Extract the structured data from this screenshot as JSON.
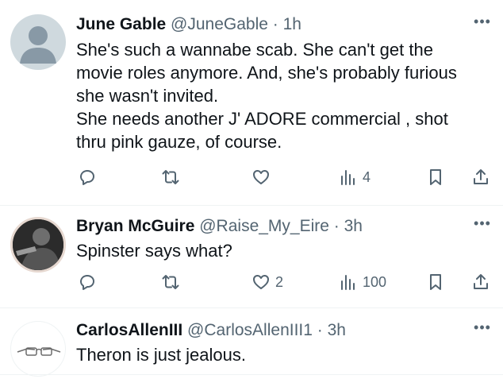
{
  "tweets": [
    {
      "name": "June Gable",
      "handle": "@JuneGable",
      "time": "1h",
      "lines": [
        "She's such a wannabe scab.  She can't get the",
        "movie roles anymore.  And, she's probably furious",
        "she wasn't invited.",
        "She needs another J' ADORE commercial , shot",
        "thru pink gauze, of course."
      ],
      "replies": "",
      "retweets": "",
      "likes": "",
      "views": "4"
    },
    {
      "name": "Bryan McGuire",
      "handle": "@Raise_My_Eire",
      "time": "3h",
      "lines": [
        "Spinster says what?"
      ],
      "replies": "",
      "retweets": "",
      "likes": "2",
      "views": "100"
    },
    {
      "name": "CarlosAllenIII",
      "handle": "@CarlosAllenIII1",
      "time": "3h",
      "lines": [
        "Theron is just jealous."
      ]
    }
  ],
  "separator": " · ",
  "more_icon": "more-horizontal-icon",
  "colors": {
    "text": "#0f1419",
    "muted": "#536471",
    "divider": "#eff3f4"
  }
}
